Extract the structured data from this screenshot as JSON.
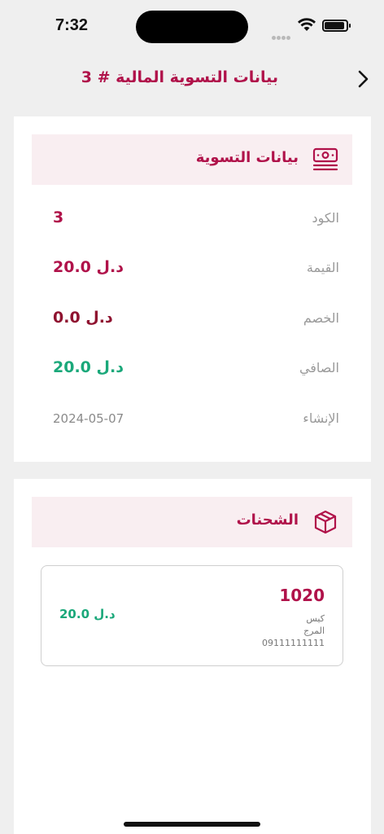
{
  "status_bar": {
    "time": "7:32"
  },
  "header": {
    "title": "بيانات التسوية المالية # 3"
  },
  "settlement": {
    "section_label": "بيانات التسوية",
    "rows": [
      {
        "label": "الكود",
        "value": "3",
        "color": "#b0124a"
      },
      {
        "label": "القيمة",
        "value": "20.0 د.ل",
        "color": "#b0124a"
      },
      {
        "label": "الخصم",
        "value": "0.0 د.ل",
        "color": "#8f1330"
      },
      {
        "label": "الصافي",
        "value": "20.0 د.ل",
        "color": "#1aa87a"
      },
      {
        "label": "الإنشاء",
        "value": "2024-05-07",
        "color": "#8a8a8a"
      }
    ]
  },
  "shipments": {
    "section_label": "الشحنات",
    "items": [
      {
        "code": "1020",
        "type": "كيس",
        "location": "المرج",
        "phone": "09111111111",
        "amount": "20.0 د.ل"
      }
    ]
  },
  "colors": {
    "accent": "#b0124a",
    "section_bg": "#f9eef1",
    "positive": "#1aa87a",
    "page_bg": "#efefef"
  }
}
